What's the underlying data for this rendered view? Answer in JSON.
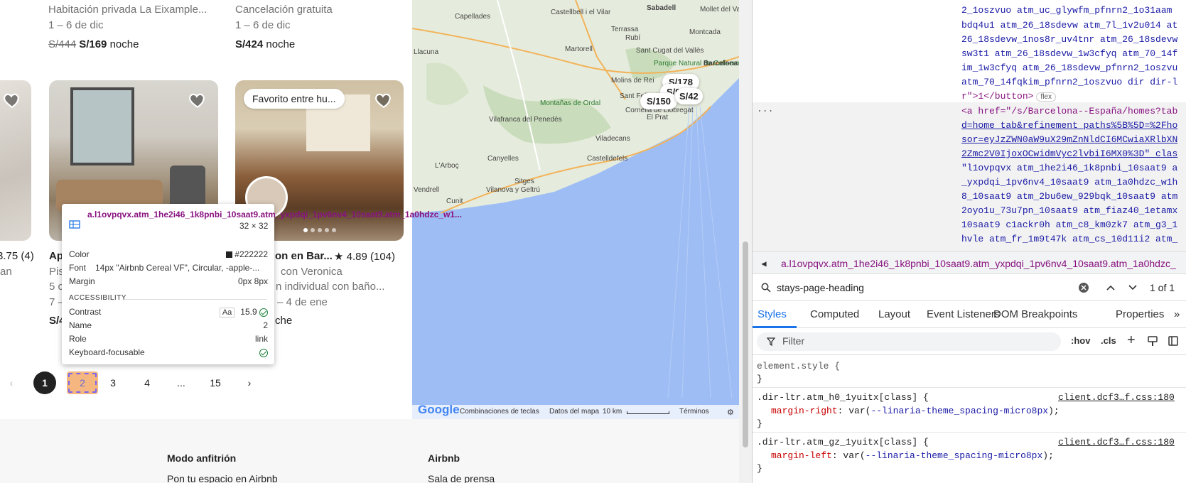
{
  "listings": {
    "top_row": [
      {
        "subtitle": "Habitación privada La Eixample...",
        "dates": "1 – 6 de dic",
        "old_price": "S/444",
        "price": "S/169",
        "unit": "noche"
      },
      {
        "subtitle": "Cancelación gratuita",
        "dates": "1 – 6 de dic",
        "price": "S/424",
        "unit": "noche"
      }
    ],
    "left_partial": {
      "rating": "3.75 (4)",
      "line": "an"
    },
    "card_middle": {
      "title": "Ap",
      "line1": "Pis",
      "line2": "5 c",
      "line3": "7 –",
      "price": "S/4"
    },
    "card_right": {
      "badge": "Favorito entre hu...",
      "title": "on en Bar...",
      "rating": "★ 4.89 (104)",
      "line1": "con Veronica",
      "line2": "n individual con baño...",
      "line3": "– 4 de ene",
      "price": "che"
    }
  },
  "pagination": {
    "prev": "‹",
    "pages": [
      "1",
      "2",
      "3",
      "4",
      "...",
      "15"
    ],
    "next": "›",
    "current": "1"
  },
  "tooltip": {
    "selector": "a.l1ovpqvx.atm_1he2i46_1k8pnbi_10saat9.atm_yxpdqi_1pv6nv4_10saat9.atm_1a0hdzc_w1...",
    "dims": "32 × 32",
    "color_label": "Color",
    "color_value": "#222222",
    "font_label": "Font",
    "font_value": "14px \"Airbnb Cereal VF\", Circular, -apple-...",
    "margin_label": "Margin",
    "margin_value": "0px 8px",
    "section": "ACCESSIBILITY",
    "contrast_label": "Contrast",
    "contrast_aa": "Aa",
    "contrast_value": "15.9",
    "name_label": "Name",
    "name_value": "2",
    "role_label": "Role",
    "role_value": "link",
    "kf_label": "Keyboard-focusable"
  },
  "map": {
    "places": [
      "Capellades",
      "Sabadell",
      "Mollet del Vallès",
      "Castellbell i el Vilar",
      "Terrassa",
      "Montcada",
      "Martorell",
      "Rubí",
      "Sant Cugat del Vallès",
      "Parque Natural de Collserola",
      "Barcelona",
      "Llacuna",
      "Molins de Rei",
      "Sant Feliu de Llobregat",
      "Montañas de Ordal",
      "Cornellà de Llobregat",
      "Vilafranca del Penedès",
      "Viladecans",
      "Castelldefels",
      "Canyelles",
      "L'Arboç",
      "Sitges",
      "Vilanova y Geltrú",
      "Vendrell",
      "Cunit",
      "El Prat"
    ],
    "pins": [
      "S/178",
      "S/95",
      "S/150",
      "S/42"
    ],
    "footer": {
      "shortcuts": "Combinaciones de teclas",
      "data": "Datos del mapa",
      "scale": "10 km",
      "terms": "Términos"
    },
    "logo": "Google"
  },
  "footer": {
    "col1": "Modo anfitrión",
    "col1_link": "Pon tu espacio en Airbnb",
    "col2": "Airbnb",
    "col2_link": "Sala de prensa"
  },
  "devtools": {
    "elements": [
      "2_1oszvuo atm_uc_glywfm_pfnrn2_1o31aam",
      "bdq4u1 atm_26_18sdevw atm_7l_1v2u014 at",
      "26_18sdevw_1nos8r_uv4tnr atm_26_18sdevw",
      "sw3t1 atm_26_18sdevw_1w3cfyq atm_70_14f",
      "im_1w3cfyq atm_26_18sdevw_pfnrn2_1oszvu",
      "atm_70_14fqkim_pfnrn2_1oszvuo dir dir-l",
      "r\">1</button>",
      "<a href=\"/s/Barcelona--España/homes?tab",
      "d=home_tab&refinement_paths%5B%5D=%2Fho",
      "sor=eyJzZWN0aW9uX29mZnNldCI6MCwiaXRlbXN",
      "2Zmc2V0IjoxOCwidmVyc2lvbiI6MX0%3D\" clas",
      "\"l1ovpqvx atm_1he2i46_1k8pnbi_10saat9 a",
      "_yxpdqi_1pv6nv4_10saat9 atm_1a0hdzc_w1h",
      "8_10saat9 atm_2bu6ew_929bqk_10saat9 atm",
      "2oyo1u_73u7pn_10saat9 atm_fiaz40_1etamx",
      "10saat9 c1ackr0h atm_c8_km0zk7 atm_g3_1",
      "hvle atm_fr_1m9t47k atm_cs_10d11i2 atm_"
    ],
    "flex_badge": "flex",
    "ellipsis": "...",
    "breadcrumb": "a.l1ovpqvx.atm_1he2i46_1k8pnbi_10saat9.atm_yxpdqi_1pv6nv4_10saat9.atm_1a0hdzc_",
    "search_query": "stays-page-heading",
    "search_count": "1 of 1",
    "tabs": [
      "Styles",
      "Computed",
      "Layout",
      "Event Listeners",
      "DOM Breakpoints",
      "Properties",
      "»"
    ],
    "filter_placeholder": "Filter",
    "hov": ":hov",
    "cls": ".cls",
    "rules": [
      {
        "selector": "element.style {",
        "close": "}"
      },
      {
        "selector": ".dir-ltr.atm_h0_1yuitx[class] {",
        "prop": "margin-right",
        "value_var": "--linaria-theme_spacing-micro8px",
        "source": "client.dcf3…f.css:180",
        "close": "}"
      },
      {
        "selector": ".dir-ltr.atm_gz_1yuitx[class] {",
        "prop": "margin-left",
        "value_var": "--linaria-theme_spacing-micro8px",
        "source": "client.dcf3…f.css:180",
        "close": "}"
      }
    ]
  }
}
